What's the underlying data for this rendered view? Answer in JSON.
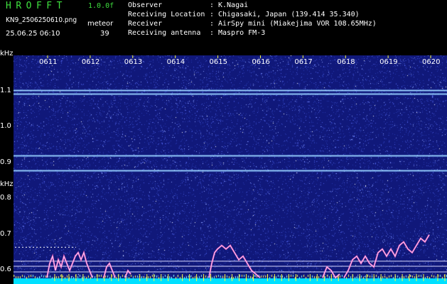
{
  "header": {
    "app_title": "HROFFT",
    "version": "1.0.0f",
    "filename": "KN9_2506250610.png",
    "meteor_label": "meteor",
    "datetime": "25.06.25 06:10",
    "meteor_count": "39",
    "colors": {
      "title": "#3fe03f",
      "text": "#ffffff",
      "background": "#000000"
    }
  },
  "info": [
    {
      "key": "Observer",
      "value": "K.Nagai"
    },
    {
      "key": "Receiving Location",
      "value": "Chigasaki, Japan (139.414 35.340)"
    },
    {
      "key": "Receiver",
      "value": "AirSpy mini (Miakejima VOR 108.65MHz)"
    },
    {
      "key": "Receiving antenna",
      "value": "Maspro FM-3"
    }
  ],
  "chart_data": {
    "type": "heatmap",
    "x_unit": "time (HHMM)",
    "x_ticks": [
      "0611",
      "0612",
      "0613",
      "0614",
      "0615",
      "0616",
      "0617",
      "0618",
      "0619",
      "0620"
    ],
    "y_unit": "kHz",
    "y_ticks": [
      1.1,
      1.0,
      0.9,
      0.8,
      0.7,
      0.6
    ],
    "y_ticks_text": [
      "1.1",
      "1.0",
      "0.9",
      "0.8",
      "0.7",
      "0.6"
    ],
    "ylim": [
      0.55,
      1.2
    ],
    "xlim": [
      0,
      10
    ],
    "carrier_lines_khz": [
      1.103,
      1.095,
      0.921,
      0.879
    ],
    "reference_lines_khz": [
      0.626,
      0.612,
      0.596
    ],
    "colors": {
      "background": "#10187a",
      "noise": "#5060e0",
      "carrier": "#a8e0ff",
      "baseline": "#00e0ff",
      "trace": "#ff60c0"
    }
  }
}
